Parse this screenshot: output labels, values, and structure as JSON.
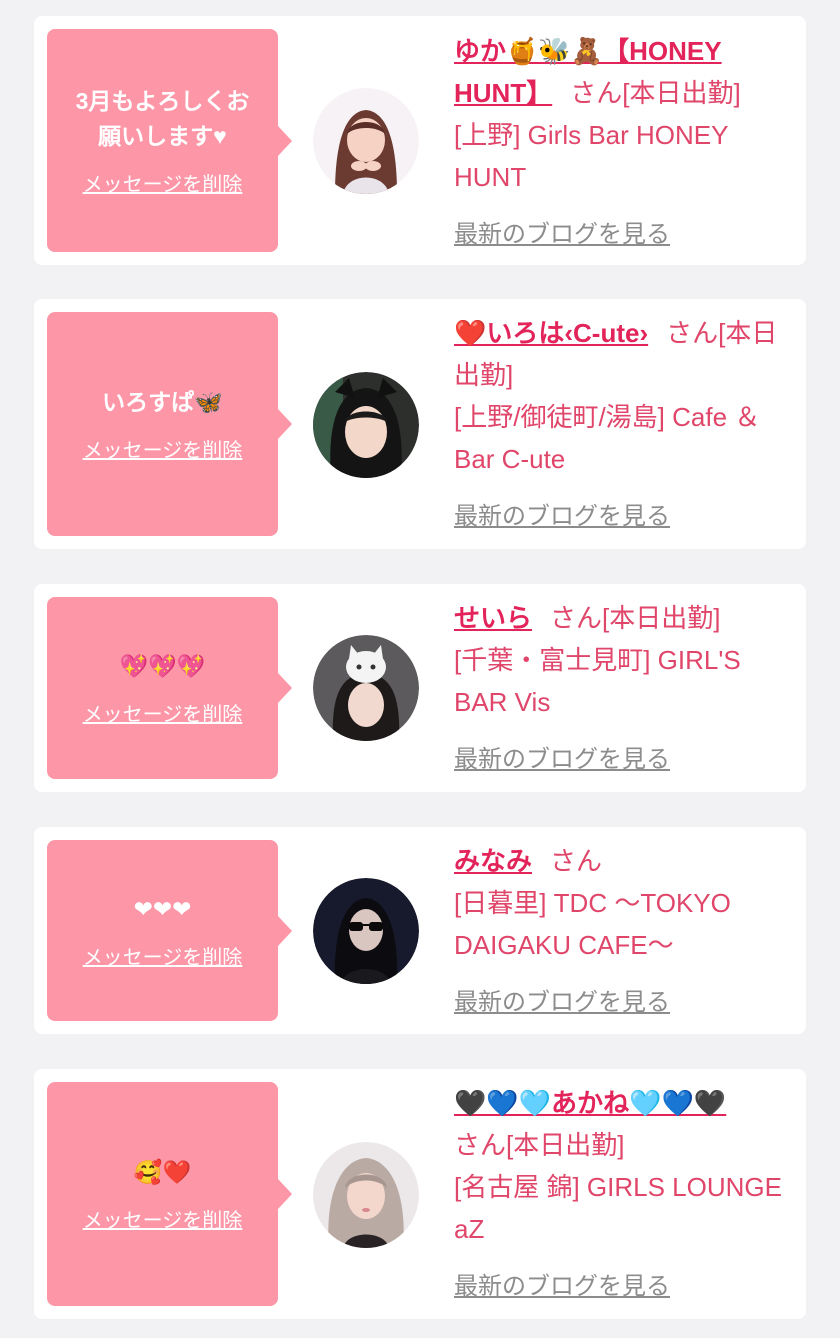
{
  "delete_label": "メッセージを削除",
  "blog_label": "最新のブログを見る",
  "cards": [
    {
      "message": "3月もよろしくお願いします♥",
      "name": "ゆか🍯🐝🧸【HONEY HUNT】",
      "status": "さん[本日出勤]",
      "shop": "[上野] Girls Bar HONEY HUNT"
    },
    {
      "message": "いろすぱ🦋",
      "name": "❤️いろは‹C-ute›",
      "status": "さん[本日出勤]",
      "shop": "[上野/御徒町/湯島] Cafe ＆Bar C-ute"
    },
    {
      "message": "💖💖💖",
      "name": "せいら",
      "status": "さん[本日出勤]",
      "shop": "[千葉・富士見町] GIRL'S BAR Vis"
    },
    {
      "message": "❤❤❤",
      "name": "みなみ",
      "status": "さん",
      "shop": "[日暮里] TDC ～TOKYO DAIGAKU CAFE～"
    },
    {
      "message": "🥰❤️",
      "name": "🖤💙🩵あかね🩵💙🖤",
      "status": "さん[本日出勤]",
      "shop": "[名古屋 錦] GIRLS LOUNGE aZ"
    }
  ],
  "colors": {
    "page_bg": "#f2f2f4",
    "bubble": "#fd97a8",
    "accent": "#e2245a",
    "muted_link": "#8c8c8c"
  }
}
